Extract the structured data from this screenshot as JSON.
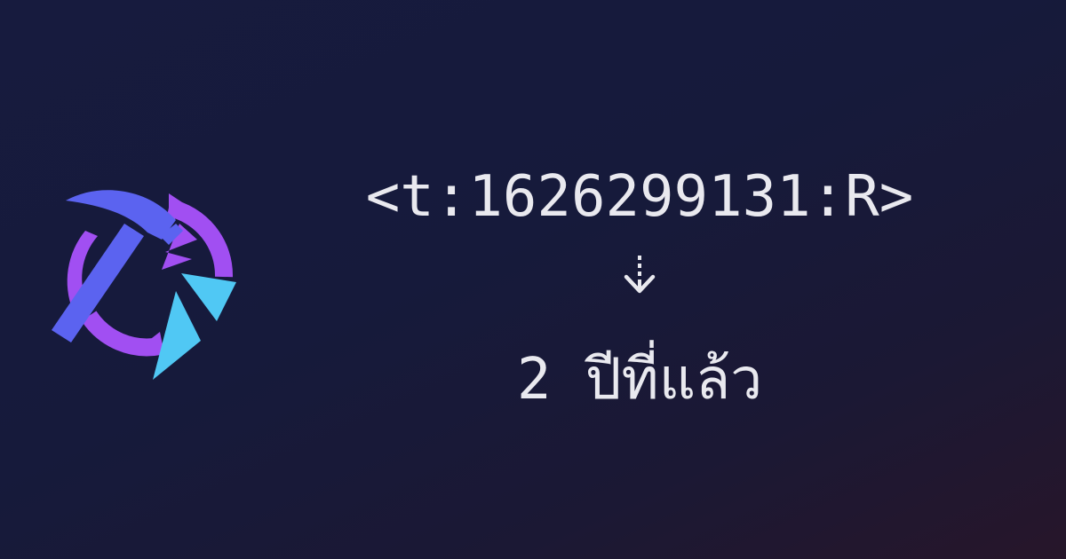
{
  "logo": {
    "icon": "hammer-clock-logo",
    "colors": {
      "hammer": "#5b63f0",
      "ring": "#a14ff2",
      "triangle": "#50c8f4"
    }
  },
  "timestamp_code": "<t:1626299131:R>",
  "arrow": {
    "icon": "dotted-arrow-down-icon",
    "color": "#e9e9ef"
  },
  "rendered_result": "2 ปีที่แล้ว",
  "colors": {
    "background_start": "#171b3e",
    "background_end": "#27162a",
    "text": "#e9e9ef"
  }
}
